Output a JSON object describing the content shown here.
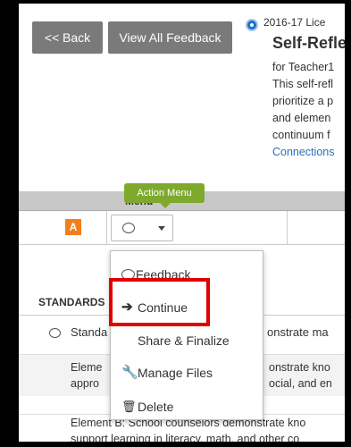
{
  "toolbar": {
    "back_label": "<< Back",
    "view_all_label": "View All Feedback"
  },
  "document": {
    "label": "2016-17 Lice",
    "title": "Self-Refle",
    "description_lines": [
      "for Teacher1",
      "This self-refl",
      "prioritize a p",
      "and elemen",
      "continuum f"
    ],
    "link_text": "Connections"
  },
  "table": {
    "menu_header": "Menu",
    "tooltip": "Action Menu",
    "row_badge": "A",
    "standards_header": "STANDARDS",
    "standard_row": {
      "left": "Standa",
      "right": "onstrate ma"
    },
    "element_a": {
      "left_l1": "Eleme",
      "left_l2": "appro",
      "right_l1": "onstrate kno",
      "right_l2": "ocial, and en"
    },
    "element_b": {
      "line1": "Element B: School counselors demonstrate kno",
      "line2": "support learning in literacy, math, and other co"
    }
  },
  "action_menu": {
    "items": [
      {
        "label": "Feedback",
        "icon": "speech-bubble-icon"
      },
      {
        "label": "Continue",
        "icon": "arrow-right-icon"
      },
      {
        "label": "Share & Finalize",
        "icon": ""
      },
      {
        "label": "Manage Files",
        "icon": "wrench-icon"
      },
      {
        "label": "Delete",
        "icon": "trash-icon"
      }
    ]
  },
  "colors": {
    "accent_green": "#7ea92c",
    "badge_orange": "#f07f1a",
    "highlight_red": "#e00000",
    "link_blue": "#2a6ebb",
    "button_gray": "#7a7a7a"
  }
}
